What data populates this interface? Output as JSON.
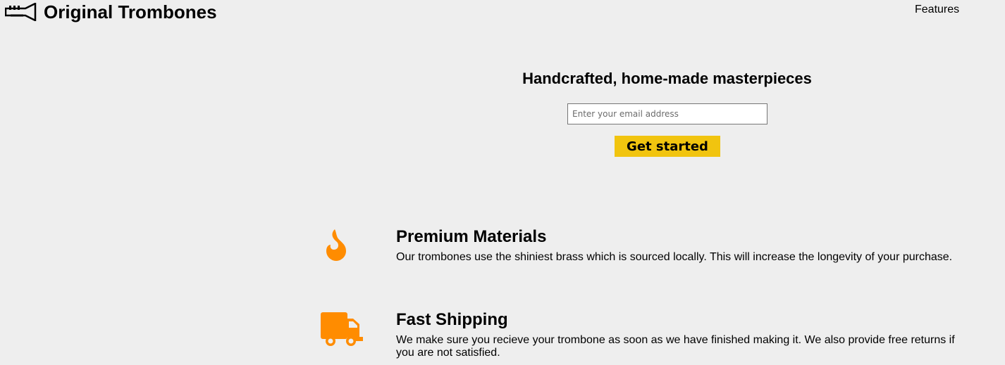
{
  "header": {
    "brand": "Original Trombones",
    "nav": {
      "features": "Features"
    }
  },
  "hero": {
    "title": "Handcrafted, home-made masterpieces",
    "email_placeholder": "Enter your email address",
    "cta": "Get started"
  },
  "features": [
    {
      "icon": "flame-icon",
      "title": "Premium Materials",
      "description": "Our trombones use the shiniest brass which is sourced locally. This will increase the longevity of your purchase."
    },
    {
      "icon": "truck-icon",
      "title": "Fast Shipping",
      "description": "We make sure you recieve your trombone as soon as we have finished making it. We also provide free returns if you are not satisfied."
    }
  ],
  "colors": {
    "accent": "#ff8c00",
    "cta": "#f1c40f",
    "background": "#eeeeee"
  }
}
